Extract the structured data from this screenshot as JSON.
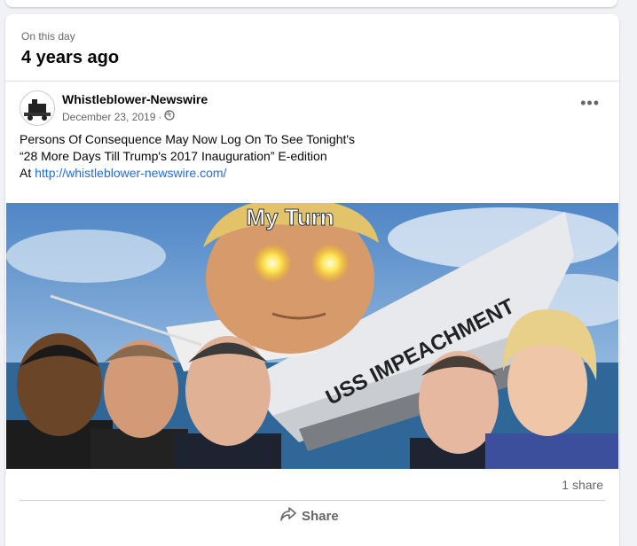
{
  "memory": {
    "label": "On this day",
    "title": "4 years ago"
  },
  "post": {
    "page_name": "Whistleblower-Newswire",
    "date": "December 23, 2019",
    "separator": "·",
    "text_line1": "Persons Of Consequence May Now Log On To See Tonight's",
    "text_line2": "“28 More Days Till Trump's 2017 Inauguration” E-edition",
    "text_line3_prefix": "At ",
    "link": "http://whistleblower-newswire.com/",
    "more": "•••",
    "image": {
      "caption_top": "My Turn",
      "ship_text": "USS IMPEACHMENT"
    },
    "share_count": "1 share",
    "share_label": "Share"
  },
  "icons": {
    "globe": "globe-icon",
    "share": "share-icon",
    "more": "more-icon"
  }
}
